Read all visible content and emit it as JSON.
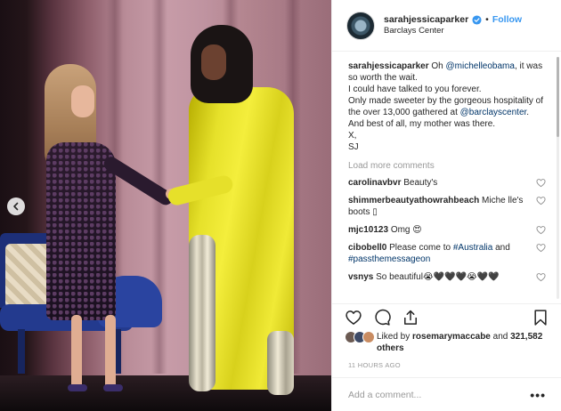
{
  "header": {
    "username": "sarahjessicaparker",
    "separator": "•",
    "follow_label": "Follow",
    "location": "Barclays Center",
    "verified_icon": "verified-badge-icon",
    "verified_color": "#3897f0"
  },
  "caption": {
    "username": "sarahjessicaparker",
    "part1": "Oh ",
    "mention1": "@michelleobama",
    "part2": ", it was so worth the wait.",
    "line2": "I could have talked to you forever.",
    "line3a": "Only made sweeter by the gorgeous hospitality of the over 13,000 gathered at ",
    "mention2": "@barclayscenter",
    "line3b": ".",
    "line4": "And best of all, my mother was there.",
    "line5": "X,",
    "line6": "SJ"
  },
  "load_more_label": "Load more comments",
  "comments": [
    {
      "user": "carolinavbvr",
      "text": "Beauty's",
      "tag": "",
      "tag2": "",
      "text2": ""
    },
    {
      "user": "shimmerbeautyathowrahbeach",
      "text": "Miche lle's boots ▯",
      "tag": "",
      "tag2": "",
      "text2": ""
    },
    {
      "user": "mjc10123",
      "text": "Omg 😍",
      "tag": "",
      "tag2": "",
      "text2": ""
    },
    {
      "user": "cibobell0",
      "text": "Please come to ",
      "tag": "#Australia",
      "text2": " and ",
      "tag2": "#passthemessageon"
    },
    {
      "user": "vsnys",
      "text": "So beautiful😭🖤🖤🖤😭🖤🖤",
      "tag": "",
      "tag2": "",
      "text2": ""
    }
  ],
  "actions": {
    "like_icon": "heart-icon",
    "comment_icon": "comment-icon",
    "share_icon": "share-icon",
    "save_icon": "bookmark-icon"
  },
  "likes": {
    "prefix": "Liked by ",
    "user": "rosemarymaccabe",
    "middle": " and ",
    "count": "321,582 others"
  },
  "time": "11 HOURS AGO",
  "add_comment": {
    "placeholder": "Add a comment...",
    "more_label": "•••"
  },
  "colors": {
    "link": "#003569",
    "follow": "#3897f0",
    "muted": "#999999",
    "border": "#efefef"
  }
}
